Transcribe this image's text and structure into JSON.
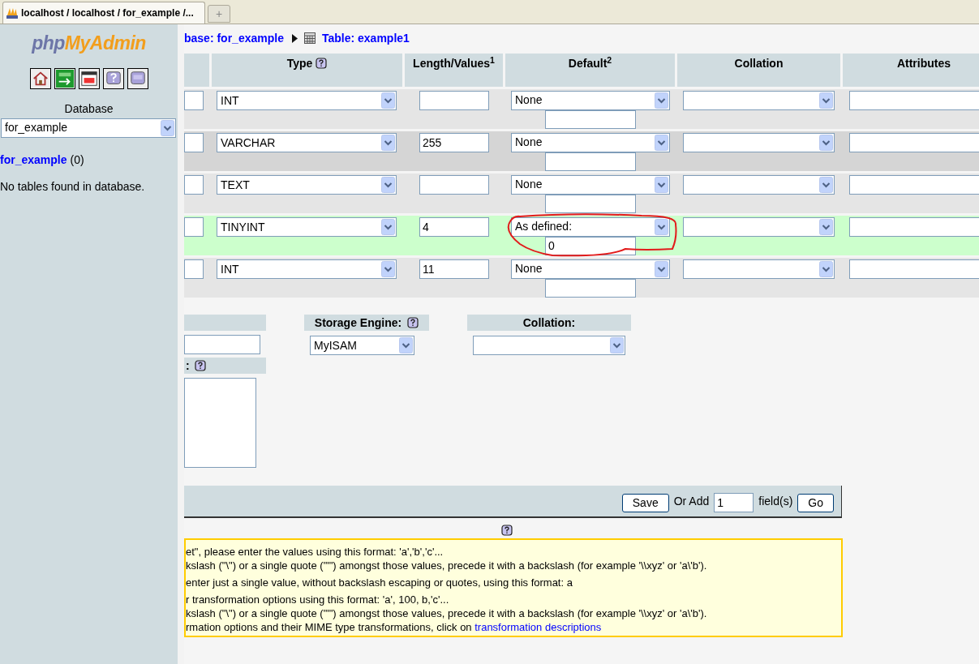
{
  "browser_tab": {
    "title": "localhost / localhost / for_example /...",
    "new_tab": "+"
  },
  "sidebar": {
    "logo_prefix": "php",
    "logo_main": "MyAdmin",
    "database_label": "Database",
    "database_select": "for_example",
    "db_link": "for_example",
    "db_count": "(0)",
    "empty_message": "No tables found in database."
  },
  "breadcrumb": {
    "database": "base: for_example",
    "table": "Table: example1"
  },
  "table": {
    "columns": [
      {
        "label": "Type",
        "help": true
      },
      {
        "label": "Length/Values$^{1}$",
        "help": false
      },
      {
        "label": "Default$^{2}$",
        "help": false
      },
      {
        "label": "Collation",
        "help": false
      },
      {
        "label": "Attributes",
        "help": false
      }
    ],
    "rows": [
      {
        "type": "INT",
        "default": "None",
        "highlighted": false,
        "annotated": false
      },
      {
        "type": "VARCHAR",
        "length": "255",
        "default": "None",
        "highlighted": false,
        "annotated": false
      },
      {
        "type": "TEXT",
        "default": "None",
        "highlighted": false,
        "annotated": false
      },
      {
        "type": "TINYINT",
        "length": "4",
        "default": "As defined:",
        "default_value": "0",
        "highlighted": true,
        "annotated": true
      },
      {
        "type": "INT",
        "length": "11",
        "default": "None",
        "highlighted": false,
        "annotated": false
      }
    ]
  },
  "options": {
    "comments_label": ":",
    "storage_engine_label": "Storage Engine:",
    "storage_engine": "MyISAM",
    "collation_label": "Collation:"
  },
  "footer": {
    "save": "Save",
    "or_add": "Or Add",
    "add_count": "1",
    "fields": "field(s)",
    "go": "Go"
  },
  "notes": [
    {
      "text": "et\", please enter the values using this format: 'a','b','c'..."
    },
    {
      "text": "kslash (\"\\\") or a single quote (\"'\") amongst those values, precede it with a backslash (for example '\\\\xyz' or 'a\\'b')."
    },
    {
      "text": "enter just a single value, without backslash escaping or quotes, using this format: a"
    },
    {
      "text": "r transformation options using this format: 'a', 100, b,'c'..."
    },
    {
      "text": "kslash (\"\\\") or a single quote (\"'\") amongst those values, precede it with a backslash (for example '\\\\xyz' or 'a\\'b')."
    },
    {
      "text": "rmation options and their MIME type transformations, click on ",
      "link": "transformation descriptions"
    }
  ]
}
